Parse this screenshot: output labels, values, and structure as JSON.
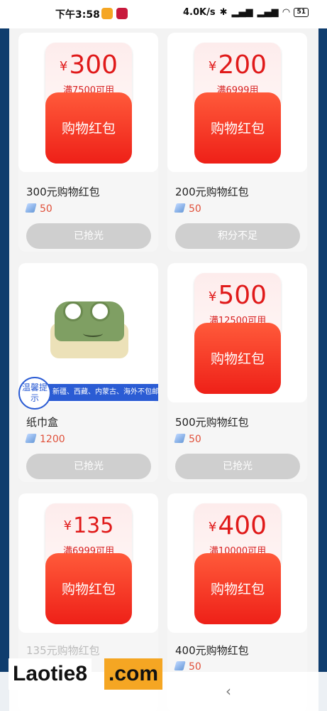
{
  "status_bar": {
    "time": "下午3:58",
    "net_speed": "4.0K/s",
    "battery": "51",
    "icons": [
      "notes-app-icon",
      "app-notification-icon",
      "bluetooth-icon",
      "signal-hd-icon",
      "signal-hd-icon",
      "wifi-icon",
      "battery-icon"
    ]
  },
  "cards": [
    {
      "type": "packet",
      "amount": "300",
      "currency": "¥",
      "condition": "满7500可用",
      "packet_title": "购物红包",
      "name": "300元购物红包",
      "points": "50",
      "button": "已抢光"
    },
    {
      "type": "packet",
      "amount": "200",
      "currency": "¥",
      "condition": "满6999用",
      "packet_title": "购物红包",
      "name": "200元购物红包",
      "points": "50",
      "button": "积分不足"
    },
    {
      "type": "product",
      "tip_label": "温馨提示",
      "tip_text": "新疆、西藏、内蒙古、海外不包邮",
      "name": "纸巾盒",
      "points": "1200",
      "button": "已抢光"
    },
    {
      "type": "packet",
      "amount": "500",
      "currency": "¥",
      "condition": "满12500可用",
      "packet_title": "购物红包",
      "name": "500元购物红包",
      "points": "50",
      "button": "已抢光"
    },
    {
      "type": "packet",
      "amount": "135",
      "currency": "¥",
      "condition": "满6999可用",
      "packet_title": "购物红包",
      "name": "135元购物红包",
      "points": "",
      "button": ""
    },
    {
      "type": "packet",
      "amount": "400",
      "currency": "¥",
      "condition": "满10000可用",
      "packet_title": "购物红包",
      "name": "400元购物红包",
      "points": "50",
      "button": ""
    }
  ],
  "watermark": {
    "part1": "Laotie8",
    "part2": ".com"
  },
  "nav": {
    "back_glyph": "‹"
  }
}
